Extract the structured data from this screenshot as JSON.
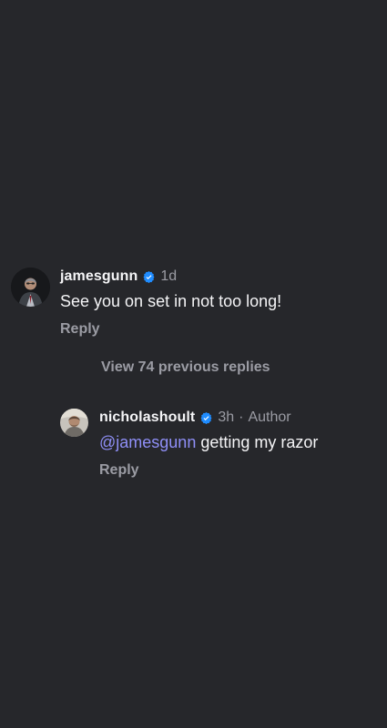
{
  "comments": [
    {
      "username": "jamesgunn",
      "verified": true,
      "timestamp": "1d",
      "text": "See you on set in not too long!",
      "reply_label": "Reply",
      "avatar_icon": "user-avatar-icon"
    },
    {
      "username": "nicholashoult",
      "verified": true,
      "timestamp": "3h",
      "separator": "·",
      "author_label": "Author",
      "mention": "@jamesgunn",
      "text": " getting my razor",
      "reply_label": "Reply",
      "avatar_icon": "user-avatar-icon"
    }
  ],
  "thread": {
    "view_replies_label": "View 74 previous replies"
  },
  "colors": {
    "background": "#26272b",
    "primary_text": "#f4f4f6",
    "secondary_text": "#9b9ca4",
    "mention": "#8f8ff7",
    "verified_badge": "#1f8cff"
  }
}
